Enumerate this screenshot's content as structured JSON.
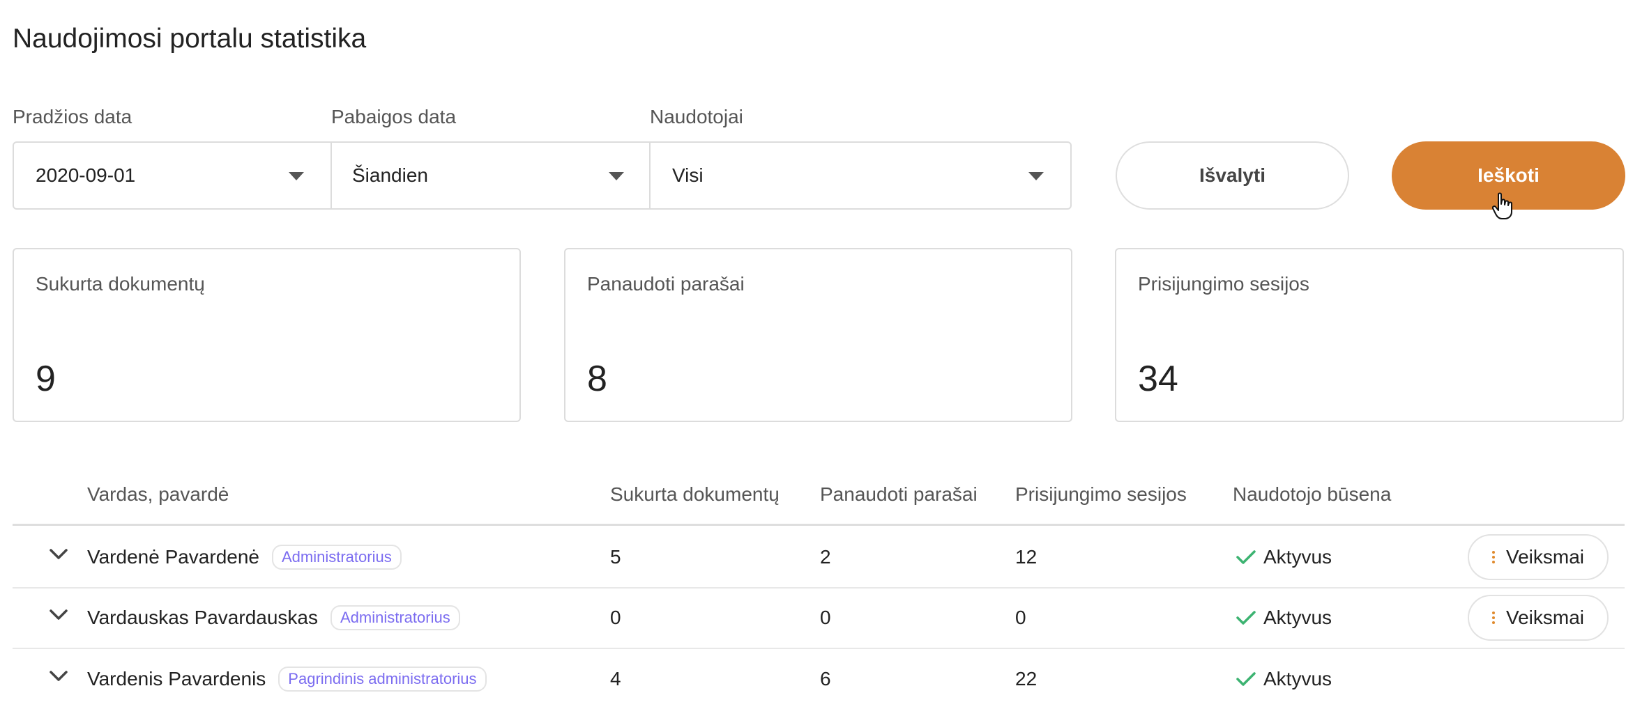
{
  "page": {
    "title": "Naudojimosi portalu statistika"
  },
  "filters": {
    "start": {
      "label": "Pradžios data",
      "value": "2020-09-01"
    },
    "end": {
      "label": "Pabaigos data",
      "value": "Šiandien"
    },
    "users": {
      "label": "Naudotojai",
      "value": "Visi"
    },
    "clear_label": "Išvalyti",
    "search_label": "Ieškoti"
  },
  "stats": [
    {
      "label": "Sukurta dokumentų",
      "value": "9"
    },
    {
      "label": "Panaudoti parašai",
      "value": "8"
    },
    {
      "label": "Prisijungimo sesijos",
      "value": "34"
    }
  ],
  "table": {
    "headers": [
      "Vardas, pavardė",
      "Sukurta dokumentų",
      "Panaudoti parašai",
      "Prisijungimo sesijos",
      "Naudotojo būsena"
    ],
    "rows": [
      {
        "name": "Vardenė Pavardenė",
        "role": "Administratorius",
        "docs": "5",
        "signatures": "2",
        "sessions": "12",
        "status": "Aktyvus",
        "action": "Veiksmai"
      },
      {
        "name": "Vardauskas Pavardauskas",
        "role": "Administratorius",
        "docs": "0",
        "signatures": "0",
        "sessions": "0",
        "status": "Aktyvus",
        "action": "Veiksmai"
      },
      {
        "name": "Vardenis Pavardenis",
        "role": "Pagrindinis administratorius",
        "docs": "4",
        "signatures": "6",
        "sessions": "22",
        "status": "Aktyvus"
      }
    ]
  },
  "colors": {
    "accent": "#d98234",
    "badge": "#7b6cf0",
    "status_ok": "#3cb371"
  },
  "icons": {
    "dropdown": "caret-down-icon",
    "expand": "chevron-down-icon",
    "status": "check-icon",
    "actions": "vertical-dots-icon",
    "cursor": "hand-pointer-icon"
  }
}
